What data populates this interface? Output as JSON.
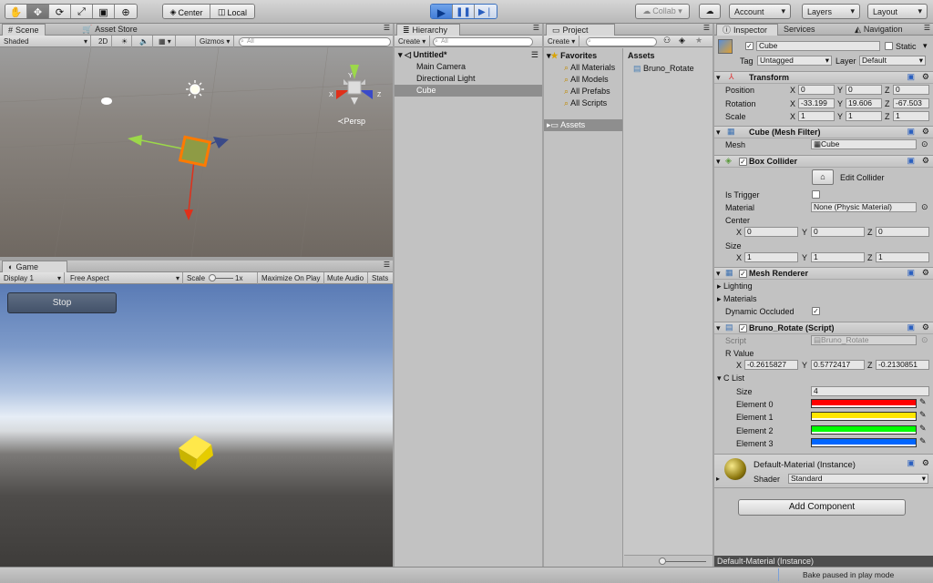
{
  "toolbar": {
    "tools": [
      "hand-icon",
      "move-icon",
      "rotate-icon",
      "scale-icon",
      "rect-icon",
      "transform-icon"
    ],
    "center_label": "Center",
    "local_label": "Local",
    "collab_label": "Collab ▾",
    "account_label": "Account",
    "layers_label": "Layers",
    "layout_label": "Layout"
  },
  "scene": {
    "tabs": [
      "Scene",
      "Asset Store"
    ],
    "shaded_label": "Shaded",
    "mode_2d": "2D",
    "gizmos_label": "Gizmos",
    "search_placeholder": "All",
    "persp_label": "Persp"
  },
  "game": {
    "tab": "Game",
    "display": "Display 1",
    "aspect": "Free Aspect",
    "scale_label": "Scale",
    "scale_value": "1x",
    "maximize": "Maximize On Play",
    "mute": "Mute Audio",
    "stats": "Stats",
    "stop_button": "Stop"
  },
  "hierarchy": {
    "tab": "Hierarchy",
    "create": "Create",
    "search_placeholder": "All",
    "scene_name": "Untitled*",
    "items": [
      "Main Camera",
      "Directional Light",
      "Cube"
    ],
    "selected": "Cube"
  },
  "project": {
    "tab": "Project",
    "create": "Create",
    "favorites_label": "Favorites",
    "favorites": [
      "All Materials",
      "All Models",
      "All Prefabs",
      "All Scripts"
    ],
    "assets_root": "Assets",
    "assets_header": "Assets",
    "assets": [
      "Bruno_Rotate"
    ]
  },
  "inspector": {
    "tabs": [
      "Inspector",
      "Services",
      "Navigation"
    ],
    "object_name": "Cube",
    "static_label": "Static",
    "tag_label": "Tag",
    "tag_value": "Untagged",
    "layer_label": "Layer",
    "layer_value": "Default",
    "transform": {
      "title": "Transform",
      "position_label": "Position",
      "position": [
        "0",
        "0",
        "0"
      ],
      "rotation_label": "Rotation",
      "rotation": [
        "-33.199",
        "19.606",
        "-67.503"
      ],
      "scale_label": "Scale",
      "scale": [
        "1",
        "1",
        "1"
      ]
    },
    "mesh_filter": {
      "title": "Cube (Mesh Filter)",
      "mesh_label": "Mesh",
      "mesh_value": "Cube"
    },
    "box_collider": {
      "title": "Box Collider",
      "edit_label": "Edit Collider",
      "is_trigger_label": "Is Trigger",
      "material_label": "Material",
      "material_value": "None (Physic Material)",
      "center_label": "Center",
      "center": [
        "0",
        "0",
        "0"
      ],
      "size_label": "Size",
      "size": [
        "1",
        "1",
        "1"
      ]
    },
    "mesh_renderer": {
      "title": "Mesh Renderer",
      "lighting": "Lighting",
      "materials": "Materials",
      "dynamic_occluded": "Dynamic Occluded"
    },
    "script": {
      "title": "Bruno_Rotate (Script)",
      "script_label": "Script",
      "script_value": "Bruno_Rotate",
      "rvalue_label": "R Value",
      "rvalue": [
        "-0.2615827",
        "0.5772417",
        "-0.2130851"
      ],
      "clist_label": "C List",
      "size_label": "Size",
      "size_value": "4",
      "elements": [
        {
          "label": "Element 0",
          "color": "#ff0000"
        },
        {
          "label": "Element 1",
          "color": "#ffe600"
        },
        {
          "label": "Element 2",
          "color": "#00ff00"
        },
        {
          "label": "Element 3",
          "color": "#0066ff"
        }
      ]
    },
    "material": {
      "title": "Default-Material (Instance)",
      "shader_label": "Shader",
      "shader_value": "Standard"
    },
    "add_component": "Add Component",
    "preview_label": "Default-Material (Instance)"
  },
  "axis": {
    "x": "X",
    "y": "Y",
    "z": "Z"
  },
  "status": {
    "text": "Bake paused in play mode"
  }
}
